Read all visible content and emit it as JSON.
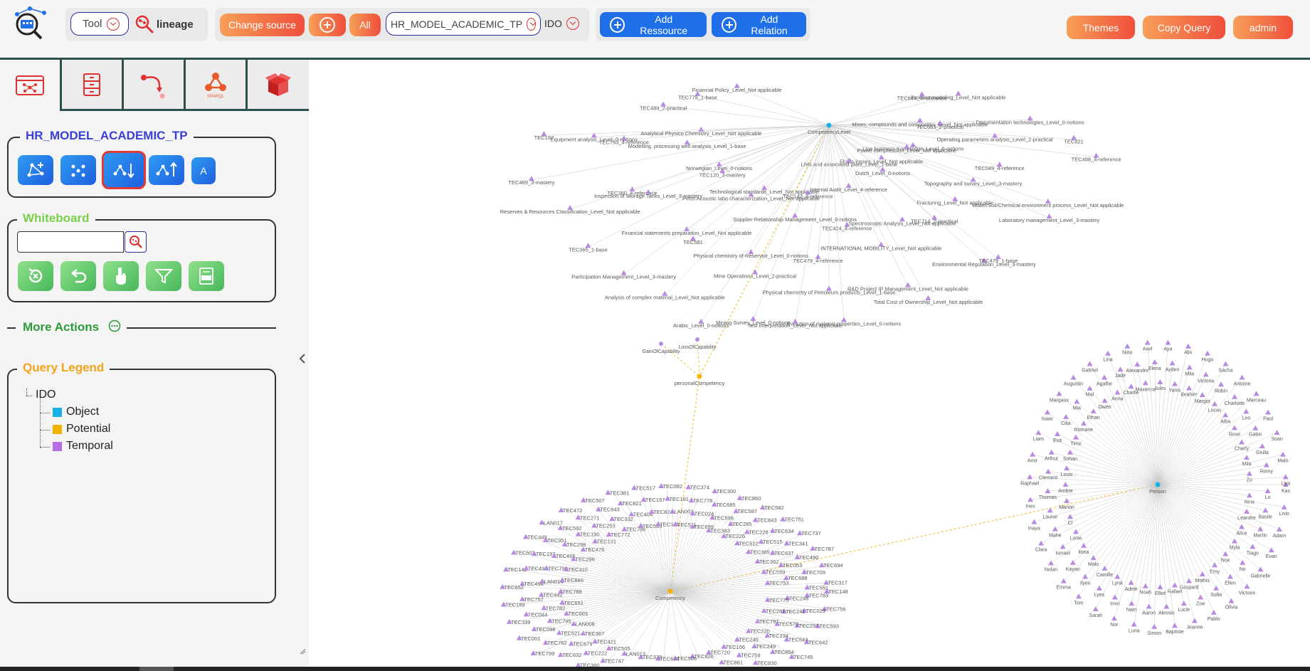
{
  "header": {
    "tool_label": "Tool",
    "lineage_label": "lineage",
    "change_source_label": "Change source",
    "all_label": "All",
    "model_select_value": "HR_MODEL_ACADEMIC_TP",
    "ido_label": "IDO",
    "add_resource_label": "Add Ressource",
    "add_relation_label": "Add Relation",
    "themes_label": "Themes",
    "copy_query_label": "Copy Query",
    "admin_label": "admin"
  },
  "tabs": [
    {
      "name": "graph-tab-icon"
    },
    {
      "name": "list-tab-icon"
    },
    {
      "name": "path-tab-icon"
    },
    {
      "name": "sparql-tab-icon",
      "label": "SPARQL"
    },
    {
      "name": "box-tab-icon"
    }
  ],
  "model_panel": {
    "title": "HR_MODEL_ACADEMIC_TP",
    "letter_button": "A"
  },
  "whiteboard": {
    "title": "Whiteboard",
    "search_placeholder": ""
  },
  "more_actions": {
    "title": "More Actions"
  },
  "query_legend": {
    "title": "Query Legend",
    "root": "IDO",
    "items": [
      {
        "label": "Object",
        "color": "#1ab0e8"
      },
      {
        "label": "Potential",
        "color": "#f0b400"
      },
      {
        "label": "Temporal",
        "color": "#b56ee6"
      }
    ]
  },
  "colors": {
    "accent_purple": "#3a3fd6",
    "whiteboard_green": "#7ccf4a",
    "legend_orange": "#f5a31a",
    "more_actions_green": "#2e9b3a",
    "edge_gray": "#c9c9c9",
    "edge_dashed": "#f0c040",
    "node_purple": "#b98be0"
  },
  "graph": {
    "hubs": [
      {
        "label": "CompetencyLevel"
      },
      {
        "label": "Competency"
      },
      {
        "label": "Person"
      },
      {
        "label": "personalCompetency"
      }
    ],
    "side_nodes": [
      "GainOfCapability",
      "LossOfCapability"
    ],
    "top_labels": [
      "Financial Policy_Level_Not applicable",
      "Process modeling_Level_Not applicable",
      "TEC489_2-practical",
      "Documentation technologies_Level_0-notions",
      "Equipment analysis_Level_0-notions",
      "TEC498_4-reference",
      "TEC489_3-mastery",
      "TEC683_2-practical",
      "Modelling, processing well analysis_Level_1-base",
      "TEC049_4-reference",
      "TEC360_4-reference",
      "Laboratory management_Level_3-mastery",
      "TEC365_1-base",
      "Line business Knowledge_Level_0-notions",
      "TEC120_3-mastery",
      "Fracturing_Level_Not applicable",
      "Financial statements preparation_Level_Not applicable",
      "Environmental Regulation_Level_3-mastery",
      "Analysis of complex material_Level_Not applicable",
      "Fluids losses_Level_Not applicable",
      "Technological standards_Level_Not applicable",
      "Spectroscopic Analysis_Level_Not applicable",
      "Physical chemistry of Reservoir_Level_0-notions",
      "R&D Project IP Management_Level_Not applicable",
      "Mining Survey_Level_0-notions",
      "LNG and associated plant_Level_1-base",
      "TEC142_4-reference",
      "TEC424_4-reference",
      "TEC479_4-reference",
      "Physical chemistry of Petroleum products_Level_1-base",
      "Evolution of material properties_Level_0-notions",
      "Test interpretation_Level_Not applicable",
      "Internal Audit_Level_4-reference",
      "Supplier Relationship Management_Level_0-notions",
      "INTERNATIONAL MOBILITY_Level_Not applicable",
      "Mine Operations_Level_2-practical",
      "Total Cost of Ownership_Level_Not applicable",
      "Arabic_Level_0-notions",
      "Dutch_Level_0-notions",
      "Petro Acoustic labo characterization_Level_Not applicable",
      "TEC714_2-practical",
      "TEC581",
      "TEC479_1-base",
      "Participation Management_Level_3-mastery",
      "Power compression_Level_Not applicable",
      "Norwegian_Level_0-notions",
      "Topography and survey_Level_3-mastery",
      "Inspection of Storage Tanks_Level_3-mastery",
      "Water/Soil/Chemical environment process_Level_Not applicable",
      "Reserves & Resources Classification_Level_Not applicable",
      "Mixes, compounds and composites_Level_Not applicable",
      "Analytical Physico Chemistry_Level_Not applicable",
      "Operating parameters analysis_Level_2-practical",
      "TEC753_4-reference",
      "TEC821",
      "TEC192",
      "TEC644_4-reference",
      "TEC779_1-base"
    ],
    "competency_labels": [
      "TEC148",
      "TEC783",
      "TEC248",
      "TEC775",
      "TEC756",
      "TEC029",
      "TEC241",
      "TEC281",
      "TEC593",
      "TEC297",
      "TEC570",
      "TEC797",
      "TEC642",
      "TEC543",
      "TEC234",
      "TEC220",
      "TEC745",
      "TEC854",
      "TEC249",
      "TEC240",
      "TEC429",
      "TEC830",
      "TEC759",
      "TEC106",
      "TEC734",
      "TEC361",
      "TEC661",
      "TEC720",
      "TEC625",
      "LAN012",
      "TEC562",
      "TEC826",
      "TEC690",
      "TEC746",
      "TEC475",
      "TEC506",
      "TEC090",
      "TEC201",
      "TEC085",
      "TEC674",
      "TEC031",
      "TEC566",
      "TEC673",
      "TEC370",
      "TEC763",
      "TEC545",
      "TEC779",
      "LAN013",
      "TEC295",
      "TEC280",
      "TEC747",
      "TEC505",
      "TEC233",
      "TEC360",
      "TEC222",
      "TEC421",
      "TEC139",
      "TEC632",
      "TEC679",
      "TEC367",
      "TEC799",
      "TEC762",
      "TEC521",
      "LAN008",
      "TEC001",
      "TEC098",
      "TEC795",
      "TEC003",
      "TEC339",
      "TEC044",
      "TEC782",
      "TEC651",
      "TEC189",
      "TEC757",
      "TEC442",
      "TEC788",
      "TEC652",
      "TEC498",
      "LAN014",
      "TEC689",
      "TEC142",
      "TEC492",
      "TEC790",
      "TEC310",
      "TEC502",
      "TEC197",
      "TEC466",
      "TEC296",
      "TEC449",
      "TEC351",
      "TEC298",
      "TEC476",
      "LAN017",
      "TEC592",
      "TEC190",
      "TEC131",
      "TEC472",
      "TEC271",
      "TEC253",
      "TEC772",
      "TEC507",
      "TEC643",
      "TEC332",
      "TEC786",
      "TEC381",
      "TEC821",
      "TEC404",
      "TEC586",
      "TEC517",
      "TEC157",
      "TEC824",
      "TEC349",
      "TEC082",
      "TEC191",
      "LAN003",
      "TEC511",
      "TEC374",
      "TEC778",
      "TEC024",
      "TEC699",
      "TEC300",
      "TEC685",
      "TEC596",
      "TEC383",
      "TEC860",
      "TEC587",
      "TEC285",
      "TEC226",
      "TEC582",
      "TEC843",
      "TEC228",
      "TEC512",
      "TEC751",
      "TEC634",
      "TEC515",
      "TEC385",
      "TEC737",
      "TEC341",
      "TEC637",
      "TEC362",
      "TEC787",
      "TEC490",
      "TEC053",
      "TEC559",
      "TEC694",
      "TEC709",
      "TEC688",
      "TEC753",
      "TEC317",
      "TEC551"
    ],
    "person_labels": [
      "Kas",
      "Lo",
      "Nina",
      "Livio",
      "Basile",
      "Leandre",
      "Adam",
      "Martin",
      "Alice",
      "Evan",
      "Tiago",
      "Myla",
      "Gabrielle",
      "No",
      "Noe",
      "Victoire",
      "Ellen",
      "Emy",
      "Olivia",
      "Sofia",
      "Mathis",
      "Pablo",
      "Zoe",
      "Gaspard",
      "Jeanne",
      "Lucie",
      "Rafael",
      "Baptiste",
      "Alessio",
      "Elliot",
      "Simon",
      "Aaron",
      "Noah",
      "Luna",
      "Nam",
      "Adele",
      "Nor",
      "Imm",
      "Lyna",
      "Sarah",
      "Lyes",
      "Camille",
      "Tom",
      "Ilyes",
      "Malo",
      "Emma",
      "Kayao",
      "Ilona",
      "Nolan",
      "Ismael",
      "Lonie",
      "Clara",
      "Mahe",
      "Cl",
      "Inaya",
      "Louise",
      "Manon",
      "Ines",
      "Thomas",
      "Ambre",
      "Raphael",
      "Clement",
      "Louis",
      "Amir",
      "Arthur",
      "Sohan",
      "Liam",
      "Eva",
      "Timo",
      "Isaac",
      "Cilia",
      "Romane",
      "Margaux",
      "Mia",
      "Ethan",
      "Augustin",
      "Mal",
      "Owen",
      "Gabriel",
      "Agathe",
      "Anna",
      "Lina",
      "Jade",
      "Charlie",
      "Nino",
      "Alexandre",
      "Maxence",
      "Axel",
      "Elena",
      "Jules",
      "Aya",
      "Ayden",
      "Yanis",
      "Alix",
      "Mila",
      "Ibrahim",
      "Hugo",
      "Victoria",
      "Margot",
      "Sacha",
      "Robin",
      "Lucas",
      "Antoine",
      "Charlotte",
      "Alba",
      "Marceau",
      "Leo",
      "Rose",
      "Paul",
      "Gabin",
      "Charly",
      "Soan",
      "Giulia",
      "Mila",
      "Malo",
      "Romy",
      "Zo",
      "Liya"
    ]
  }
}
